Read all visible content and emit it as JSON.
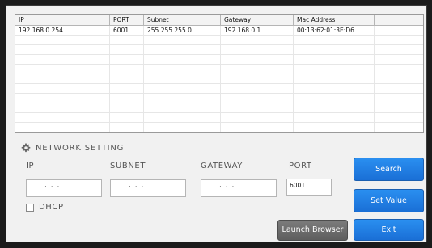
{
  "table": {
    "headers": [
      "IP",
      "PORT",
      "Subnet",
      "Gateway",
      "Mac Address",
      ""
    ],
    "rows": [
      [
        "192.168.0.254",
        "6001",
        "255.255.255.0",
        "192.168.0.1",
        "00:13:62:01:3E:D6",
        ""
      ]
    ]
  },
  "network_setting": {
    "title": "NETWORK SETTING",
    "gear_icon": "gear-icon",
    "labels": {
      "ip": "IP",
      "subnet": "SUBNET",
      "gateway": "GATEWAY",
      "port": "PORT"
    },
    "port_value": "6001",
    "dhcp_label": "DHCP",
    "dhcp_checked": false
  },
  "buttons": {
    "search": "Search",
    "set_value": "Set Value",
    "exit": "Exit",
    "launch_browser": "Launch Browser"
  },
  "colors": {
    "accent_blue": "#1a6fd6",
    "gray_button": "#6b6b6b"
  }
}
